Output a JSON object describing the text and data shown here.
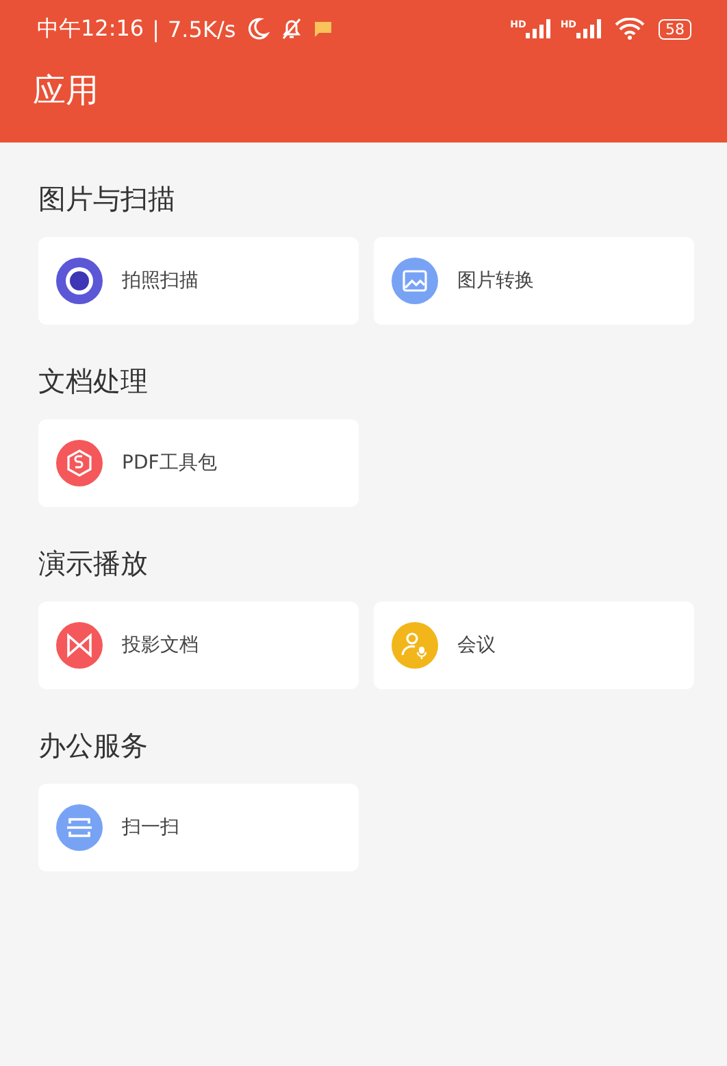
{
  "status_bar": {
    "time": "中午12:16",
    "separator": "|",
    "speed": "7.5K/s",
    "signals": [
      {
        "label": "HD"
      },
      {
        "label": "HD"
      }
    ],
    "battery": "58"
  },
  "header": {
    "title": "应用"
  },
  "sections": [
    {
      "title": "图片与扫描",
      "items": [
        {
          "label": "拍照扫描",
          "kind": "camera",
          "color": "#5b57d6"
        },
        {
          "label": "图片转换",
          "kind": "image",
          "color": "#78a3f5"
        }
      ]
    },
    {
      "title": "文档处理",
      "items": [
        {
          "label": "PDF工具包",
          "kind": "pdf",
          "color": "#f4585a"
        }
      ]
    },
    {
      "title": "演示播放",
      "items": [
        {
          "label": "投影文档",
          "kind": "projection",
          "color": "#f4585a"
        },
        {
          "label": "会议",
          "kind": "meeting",
          "color": "#f2b61a"
        }
      ]
    },
    {
      "title": "办公服务",
      "items": [
        {
          "label": "扫一扫",
          "kind": "scan",
          "color": "#78a3f5"
        }
      ]
    }
  ]
}
